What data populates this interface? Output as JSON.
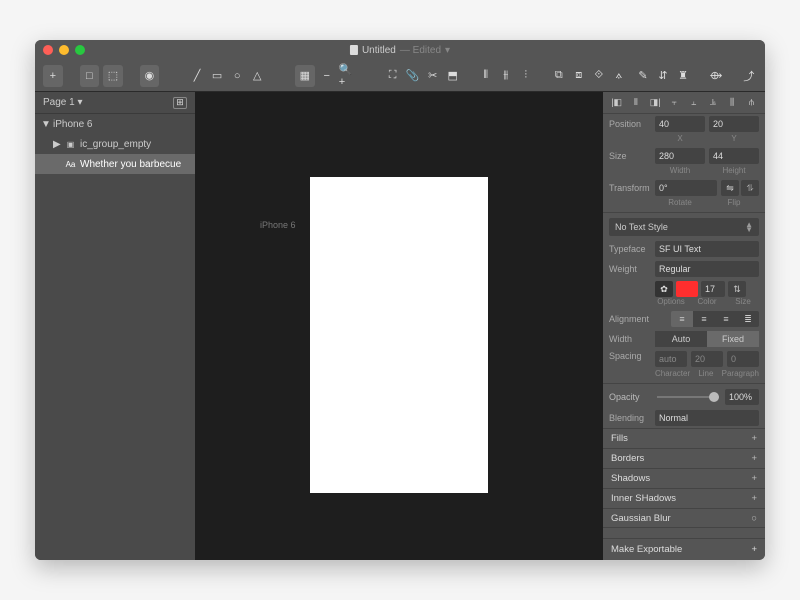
{
  "title": {
    "filename": "Untitled",
    "status": "— Edited",
    "dropdown": "▾"
  },
  "toolbar": {
    "add": "+",
    "group": "□",
    "ungroup": "⬚",
    "insert": "◉",
    "line": "╱",
    "rect": "▭",
    "oval": "○",
    "tri": "△",
    "grid": "▦",
    "zoomOut": "−",
    "zoomIn": "🔍+",
    "crop": "⛶",
    "attach": "📎",
    "cut": "✂",
    "flatten": "⬒",
    "dist1": "⫴",
    "dist2": "⫵",
    "dist3": "⫶",
    "fwd": "⧉",
    "back": "⧈",
    "front": "⟐",
    "rear": "⟑",
    "pencil": "✎",
    "mirror": "⇵",
    "tree": "♜",
    "export": "⟴",
    "share": "⤴"
  },
  "left": {
    "page": "Page 1",
    "pageDrop": "▾",
    "layers": [
      {
        "name": "iPhone 6",
        "tri": "▼"
      },
      {
        "name": "ic_group_empty",
        "tri": "▶",
        "icon": "▣"
      },
      {
        "name": "Whether you barbecue",
        "icon": "Aa"
      }
    ]
  },
  "canvas": {
    "artboard": "iPhone 6"
  },
  "inspector": {
    "position": {
      "label": "Position",
      "x": "40",
      "y": "20",
      "xlabel": "X",
      "ylabel": "Y"
    },
    "size": {
      "label": "Size",
      "w": "280",
      "h": "44",
      "wlabel": "Width",
      "hlabel": "Height"
    },
    "transform": {
      "label": "Transform",
      "rot": "0°",
      "rotlabel": "Rotate",
      "fliplabel": "Flip"
    },
    "textStyle": "No Text Style",
    "typeface": {
      "label": "Typeface",
      "value": "SF UI Text"
    },
    "weight": {
      "label": "Weight",
      "value": "Regular"
    },
    "options": {
      "optLabel": "Options",
      "colorLabel": "Color",
      "sizeLabel": "Size",
      "size": "17",
      "color": "#ff2e2e"
    },
    "alignment": {
      "label": "Alignment"
    },
    "width": {
      "label": "Width",
      "auto": "Auto",
      "fixed": "Fixed"
    },
    "spacing": {
      "label": "Spacing",
      "char": "auto",
      "line": "20",
      "para": "0",
      "charLabel": "Character",
      "lineLabel": "Line",
      "paraLabel": "Paragraph"
    },
    "opacity": {
      "label": "Opacity",
      "value": "100%"
    },
    "blending": {
      "label": "Blending",
      "value": "Normal"
    },
    "sections": {
      "fills": "Fills",
      "borders": "Borders",
      "shadows": "Shadows",
      "inner": "Inner SHadows",
      "blur": "Gaussian Blur"
    },
    "export": "Make Exportable"
  }
}
